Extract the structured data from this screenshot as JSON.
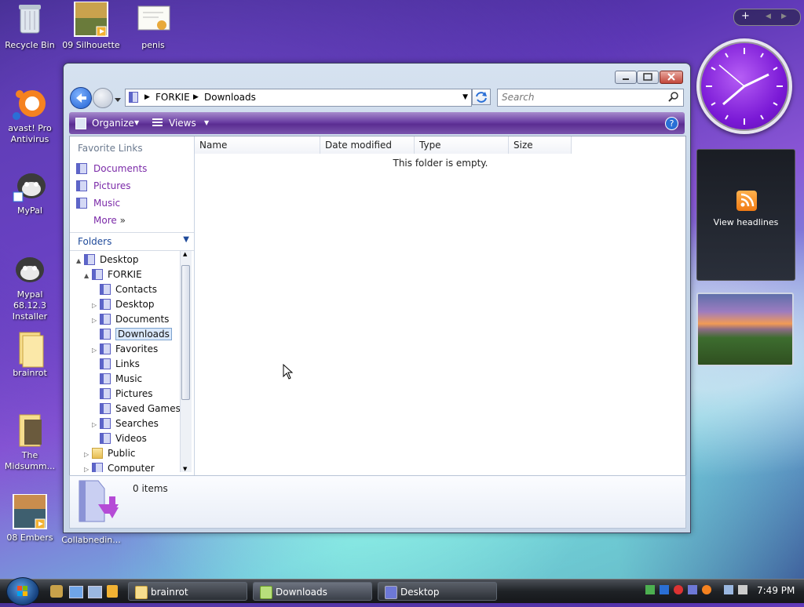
{
  "desktop": {
    "icons": [
      {
        "label": "Recycle Bin"
      },
      {
        "label": "09 Silhouette"
      },
      {
        "label": "penis"
      },
      {
        "label": "avast! Pro Antivirus"
      },
      {
        "label": "MyPal"
      },
      {
        "label": "Mypal 68.12.3 Installer"
      },
      {
        "label": "brainrot"
      },
      {
        "label": "The Midsumm..."
      },
      {
        "label": "08 Embers"
      },
      {
        "label": "Collabnedin..."
      }
    ]
  },
  "explorer": {
    "breadcrumb": [
      "FORKIE",
      "Downloads"
    ],
    "search_placeholder": "Search",
    "toolbar": {
      "organize": "Organize",
      "views": "Views"
    },
    "favorite_links_title": "Favorite Links",
    "favorite_links": [
      "Documents",
      "Pictures",
      "Music"
    ],
    "more": "More",
    "folders_title": "Folders",
    "tree": [
      {
        "label": "Desktop",
        "level": 0,
        "arrow": "▲"
      },
      {
        "label": "FORKIE",
        "level": 1,
        "arrow": "▲"
      },
      {
        "label": "Contacts",
        "level": 2,
        "arrow": ""
      },
      {
        "label": "Desktop",
        "level": 2,
        "arrow": "▷"
      },
      {
        "label": "Documents",
        "level": 2,
        "arrow": "▷"
      },
      {
        "label": "Downloads",
        "level": 2,
        "arrow": "",
        "selected": true
      },
      {
        "label": "Favorites",
        "level": 2,
        "arrow": "▷"
      },
      {
        "label": "Links",
        "level": 2,
        "arrow": ""
      },
      {
        "label": "Music",
        "level": 2,
        "arrow": ""
      },
      {
        "label": "Pictures",
        "level": 2,
        "arrow": ""
      },
      {
        "label": "Saved Games",
        "level": 2,
        "arrow": ""
      },
      {
        "label": "Searches",
        "level": 2,
        "arrow": "▷"
      },
      {
        "label": "Videos",
        "level": 2,
        "arrow": ""
      },
      {
        "label": "Public",
        "level": 1,
        "arrow": "▷"
      },
      {
        "label": "Computer",
        "level": 1,
        "arrow": "▷"
      }
    ],
    "columns": [
      "Name",
      "Date modified",
      "Type",
      "Size"
    ],
    "empty_message": "This folder is empty.",
    "item_count": "0 items"
  },
  "gadgets": {
    "feed_label": "View headlines"
  },
  "taskbar": {
    "tasks": [
      "brainrot",
      "Downloads",
      "Desktop"
    ],
    "time": "7:49 PM"
  },
  "colors": {
    "accent": "#6b3fa3",
    "link": "#7b2aa8"
  }
}
